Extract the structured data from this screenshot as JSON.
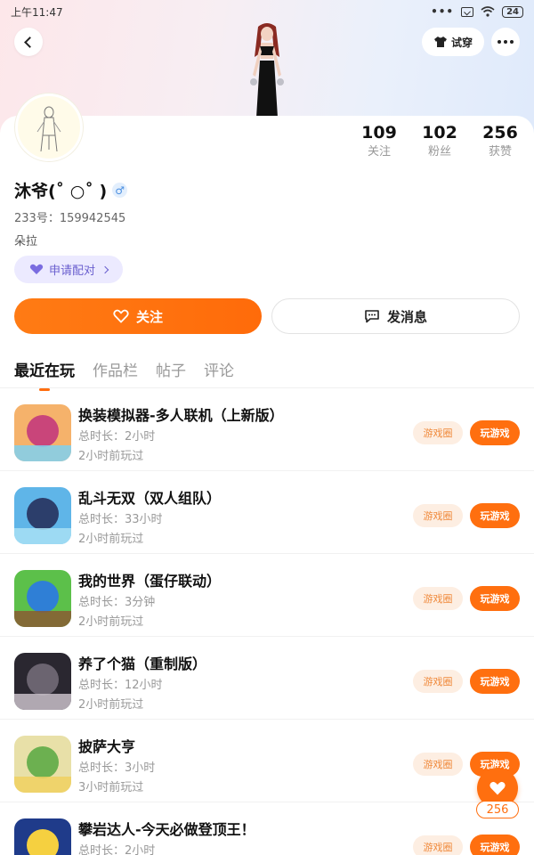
{
  "status_bar": {
    "time": "上午11:47",
    "dots": "•••",
    "battery": "24"
  },
  "header": {
    "try_on_label": "试穿"
  },
  "stats": [
    {
      "value": "109",
      "label": "关注"
    },
    {
      "value": "102",
      "label": "粉丝"
    },
    {
      "value": "256",
      "label": "获赞"
    }
  ],
  "user": {
    "name": "沐爷(˚ ○˚ )",
    "gender_icon": "♂",
    "id_line": "233号：159942545",
    "signature": "朵拉"
  },
  "pair_button": {
    "label": "申请配对"
  },
  "actions": {
    "follow_label": "关注",
    "message_label": "发消息"
  },
  "tabs": [
    {
      "label": "最近在玩",
      "active": true
    },
    {
      "label": "作品栏",
      "active": false
    },
    {
      "label": "帖子",
      "active": false
    },
    {
      "label": "评论",
      "active": false
    }
  ],
  "games": [
    {
      "title": "换装模拟器-多人联机（上新版）",
      "duration": "总时长：2小时",
      "last_played": "2小时前玩过",
      "circle_label": "游戏圈",
      "play_label": "玩游戏",
      "icon_colors": [
        "#f5b26b",
        "#c9457a",
        "#7fd0f0"
      ]
    },
    {
      "title": "乱斗无双（双人组队）",
      "duration": "总时长：33小时",
      "last_played": "2小时前玩过",
      "circle_label": "游戏圈",
      "play_label": "玩游戏",
      "icon_colors": [
        "#5fb5e8",
        "#2c3e6b",
        "#a8e0f5"
      ]
    },
    {
      "title": "我的世界（蛋仔联动）",
      "duration": "总时长：3分钟",
      "last_played": "2小时前玩过",
      "circle_label": "游戏圈",
      "play_label": "玩游戏",
      "icon_colors": [
        "#5cc04a",
        "#2f7fd6",
        "#8a5a33"
      ]
    },
    {
      "title": "养了个猫（重制版）",
      "duration": "总时长：12小时",
      "last_played": "2小时前玩过",
      "circle_label": "游戏圈",
      "play_label": "玩游戏",
      "icon_colors": [
        "#2a2730",
        "#6b6470",
        "#c8c0c8"
      ]
    },
    {
      "title": "披萨大亨",
      "duration": "总时长：3小时",
      "last_played": "3小时前玩过",
      "circle_label": "游戏圈",
      "play_label": "玩游戏",
      "icon_colors": [
        "#e8e0a8",
        "#6cb050",
        "#f0d060"
      ]
    },
    {
      "title": "攀岩达人-今天必做登顶王！",
      "duration": "总时长：2小时",
      "last_played": "",
      "circle_label": "游戏圈",
      "play_label": "玩游戏",
      "icon_colors": [
        "#1f3b8a",
        "#f5d040",
        "#3a5fcf"
      ]
    }
  ],
  "like_fab": {
    "count": "256"
  },
  "colors": {
    "accent": "#ff6f0f",
    "pair": "#6a5fcf"
  }
}
